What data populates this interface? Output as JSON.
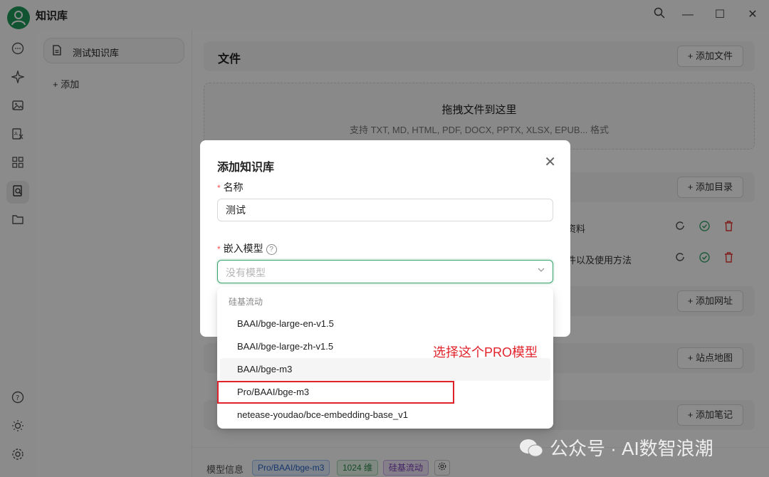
{
  "app": {
    "title": "知识库"
  },
  "window": {
    "search_icon": "search-icon",
    "minimize": "—",
    "maximize": "☐",
    "close": "✕"
  },
  "rail": {
    "icons": [
      "chat-icon",
      "sparkle-icon",
      "image-icon",
      "translate-icon",
      "apps-icon",
      "knowledge-icon",
      "folder-icon",
      "help-icon",
      "theme-icon",
      "settings-icon"
    ]
  },
  "kb_list": {
    "items": [
      {
        "label": "测试知识库"
      }
    ],
    "add_label": "+ 添加"
  },
  "main": {
    "files": {
      "title": "文件",
      "add_button": "+ 添加文件"
    },
    "dropzone": {
      "title": "拖拽文件到这里",
      "subtitle": "支持 TXT, MD, HTML, PDF, DOCX, PPTX, XLSX, EPUB... 格式"
    },
    "directories": {
      "add_button": "+ 添加目录",
      "rows": [
        {
          "text": "资料"
        },
        {
          "text": "件以及使用方法"
        }
      ]
    },
    "urls": {
      "add_button": "+ 添加网址"
    },
    "sitemap": {
      "add_button": "+ 站点地图"
    },
    "notes": {
      "add_button": "+ 添加笔记"
    },
    "footer": {
      "label": "模型信息",
      "tags": [
        "Pro/BAAI/bge-m3",
        "1024 维",
        "硅基流动"
      ]
    }
  },
  "modal": {
    "title": "添加知识库",
    "close": "✕",
    "name_label": "名称",
    "name_value": "测试",
    "model_label": "嵌入模型",
    "model_placeholder": "没有模型"
  },
  "dropdown": {
    "group": "硅基流动",
    "options": [
      "BAAI/bge-large-en-v1.5",
      "BAAI/bge-large-zh-v1.5",
      "BAAI/bge-m3",
      "Pro/BAAI/bge-m3",
      "netease-youdao/bce-embedding-base_v1"
    ]
  },
  "annotation": {
    "text": "选择这个PRO模型"
  },
  "watermark": {
    "text": "公众号 · AI数智浪潮"
  },
  "colors": {
    "accent": "#37a36b",
    "annotation_red": "#e0232b",
    "danger": "#e53935"
  }
}
